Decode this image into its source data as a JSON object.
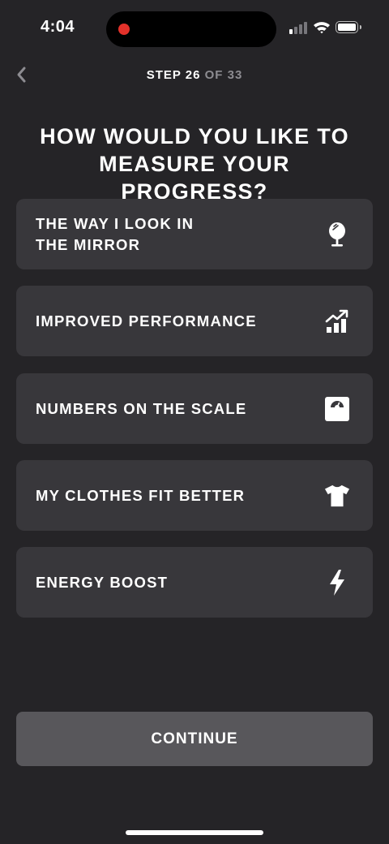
{
  "status_bar": {
    "time": "4:04"
  },
  "header": {
    "step_current": "STEP 26",
    "step_total": " OF 33"
  },
  "question": {
    "title": "HOW WOULD YOU LIKE TO\nMEASURE YOUR PROGRESS?"
  },
  "options": [
    {
      "label": "THE WAY I LOOK IN\nTHE MIRROR",
      "icon": "mirror-icon"
    },
    {
      "label": "IMPROVED PERFORMANCE",
      "icon": "performance-chart-icon"
    },
    {
      "label": "NUMBERS ON THE SCALE",
      "icon": "scale-icon"
    },
    {
      "label": "MY CLOTHES FIT BETTER",
      "icon": "tshirt-icon"
    },
    {
      "label": "ENERGY BOOST",
      "icon": "lightning-icon"
    }
  ],
  "continue_label": "CONTINUE",
  "colors": {
    "background": "#252427",
    "card": "#38373b",
    "button": "#58575b",
    "muted_text": "#8d8c91",
    "record_dot": "#e3312a"
  }
}
